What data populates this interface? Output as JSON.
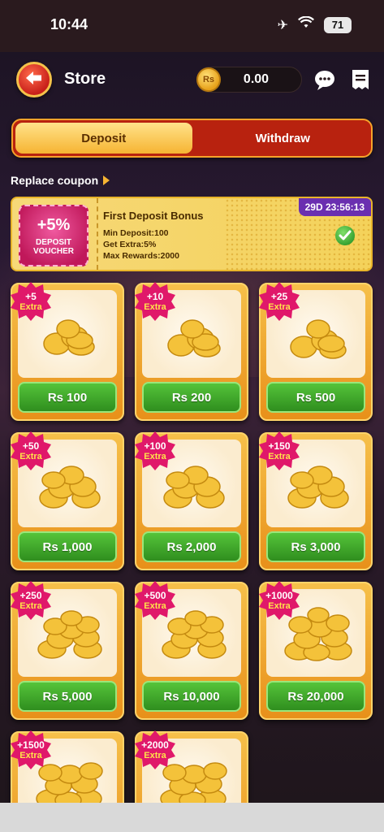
{
  "status_bar": {
    "time": "10:44",
    "battery": "71"
  },
  "header": {
    "title": "Store",
    "balance": "0.00",
    "currency_badge": "Rs"
  },
  "tabs": [
    {
      "label": "Deposit",
      "active": true
    },
    {
      "label": "Withdraw",
      "active": false
    }
  ],
  "coupon": {
    "replace_label": "Replace coupon",
    "voucher": {
      "percent": "+5%",
      "badge_line1": "DEPOSIT",
      "badge_line2": "VOUCHER",
      "title": "First Deposit Bonus",
      "min_deposit": "Min Deposit:100",
      "get_extra": "Get Extra:5%",
      "max_rewards": "Max Rewards:2000",
      "timer": "29D 23:56:13"
    }
  },
  "products": [
    {
      "extra": "+5",
      "extra_word": "Extra",
      "price": "Rs 100"
    },
    {
      "extra": "+10",
      "extra_word": "Extra",
      "price": "Rs 200"
    },
    {
      "extra": "+25",
      "extra_word": "Extra",
      "price": "Rs 500"
    },
    {
      "extra": "+50",
      "extra_word": "Extra",
      "price": "Rs 1,000"
    },
    {
      "extra": "+100",
      "extra_word": "Extra",
      "price": "Rs 2,000"
    },
    {
      "extra": "+150",
      "extra_word": "Extra",
      "price": "Rs 3,000"
    },
    {
      "extra": "+250",
      "extra_word": "Extra",
      "price": "Rs 5,000"
    },
    {
      "extra": "+500",
      "extra_word": "Extra",
      "price": "Rs 10,000"
    },
    {
      "extra": "+1000",
      "extra_word": "Extra",
      "price": "Rs 20,000"
    },
    {
      "extra": "+1500",
      "extra_word": "Extra",
      "price": ""
    },
    {
      "extra": "+2000",
      "extra_word": "Extra",
      "price": ""
    }
  ],
  "colors": {
    "accent_orange": "#f6b432",
    "tab_red": "#b8220f",
    "price_green": "#3faa2a",
    "extra_pink": "#e0186a",
    "timer_purple": "#6a2fb0"
  },
  "icons": {
    "back": "back-arrow-icon",
    "coin": "rupee-coin-icon",
    "support": "chat-support-icon",
    "history": "receipt-icon",
    "check": "check-icon"
  }
}
